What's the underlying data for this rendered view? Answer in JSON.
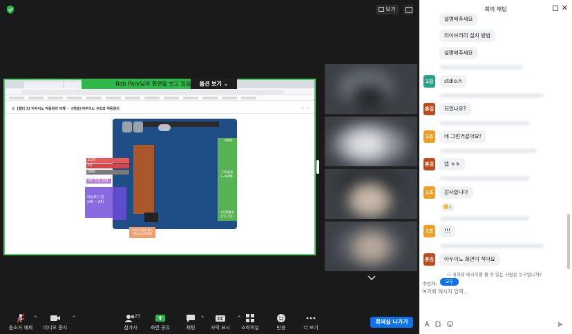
{
  "meeting": {
    "view_label": "보기",
    "share_banner": "Bob Park님의 화면을 보고 있습니다.",
    "options_label": "옵션 보기"
  },
  "shared_screen": {
    "breadcrumb_part1": "[챕터 3] 아두이노 작동원리 이해",
    "breadcrumb_part2": "[개념] 아두이노 구조와 작동원리",
    "pin_labels": {
      "v33": "3.3V",
      "v5": "5V",
      "gnd_left": "GND",
      "vin": "Vin 전압 전원",
      "analog": "아날로그 핀",
      "analog_range": "(A0 ~ A5)",
      "gnd_right": "GND",
      "digital": "디지털핀",
      "digital_sub": "(~PWM)",
      "serial": "시리얼통신",
      "serial_sub": "(TX, RX)",
      "atmega": "마이크로컨트롤러",
      "atmega_sub": "(Atmega328P)"
    }
  },
  "toolbar": {
    "mute": "음소거 해제",
    "video": "비디오 중지",
    "participants": "참가자",
    "participants_count": "23",
    "share": "화면 공유",
    "chat": "채팅",
    "captions": "자막 표시",
    "breakout": "소회의실",
    "reactions": "반응",
    "more": "더 보기",
    "leave": "회의실 나가기"
  },
  "chat": {
    "title": "회의 채팅",
    "messages": [
      {
        "text": "설명해주세요"
      },
      {
        "text": "라이브러리 설치 방법"
      },
      {
        "text": "설명해주세요"
      },
      {
        "avatar": "1김",
        "text": "stdio.h"
      },
      {
        "avatar": "휴김",
        "text": "되었나요?"
      },
      {
        "avatar": "1조",
        "text": "네 그런거같아요!"
      },
      {
        "avatar": "휴김",
        "text": "넵 ㅎㅎ"
      },
      {
        "avatar": "1조",
        "text": "감사합니다",
        "reaction_count": "1"
      },
      {
        "avatar": "1조",
        "text": "!!!"
      },
      {
        "avatar": "휴김",
        "text": "아두이노 화면이 작아요"
      }
    ],
    "visibility_note": "귀하의 메시지를 볼 수 있는 사람은 누구입니까?",
    "recipient_label": "수신자:",
    "recipient_value": "모두",
    "input_placeholder": "여기에 메시지 입력..."
  },
  "colors": {
    "accent_blue": "#0e72ed",
    "share_green": "#2fb84a",
    "avatar_green": "#23a489",
    "avatar_brown": "#c04b1a",
    "avatar_orange": "#f0a020"
  }
}
